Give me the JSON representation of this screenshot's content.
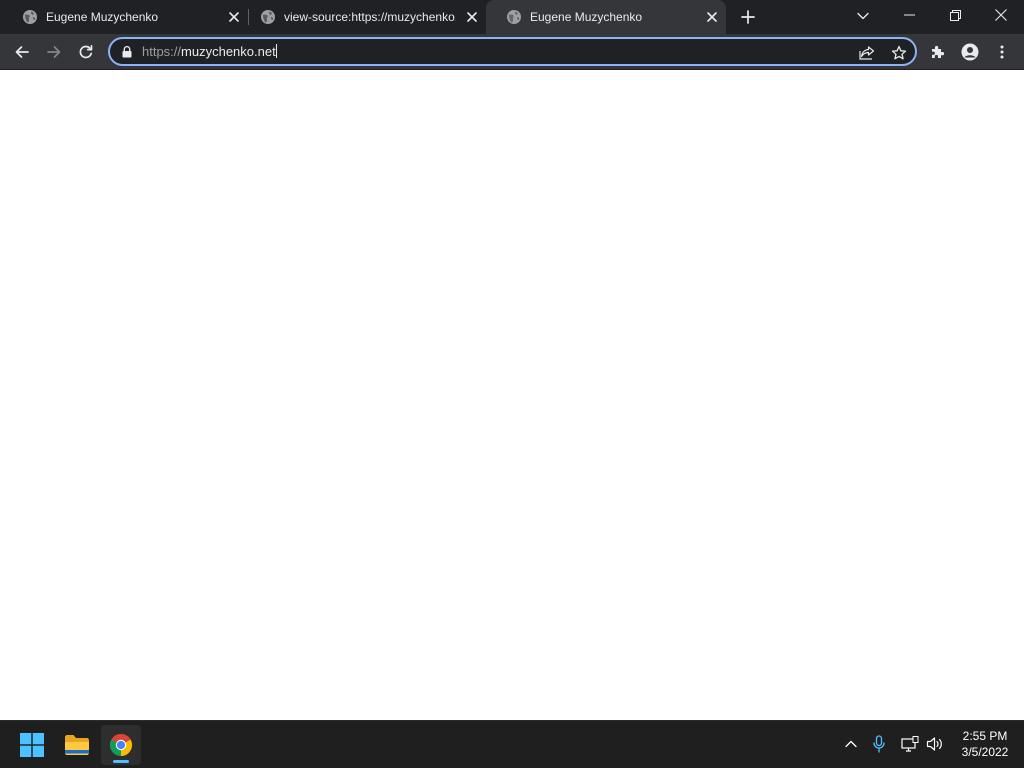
{
  "browser": {
    "tabs": [
      {
        "title": "Eugene Muzychenko",
        "active": false,
        "favicon": "globe-icon"
      },
      {
        "title": "view-source:https://muzychenko.net/",
        "active": false,
        "favicon": "globe-icon"
      },
      {
        "title": "Eugene Muzychenko",
        "active": true,
        "favicon": "globe-icon"
      }
    ],
    "omnibox": {
      "scheme": "https://",
      "host": "muzychenko.net"
    },
    "icons": {
      "back": "arrow-left-icon",
      "forward": "arrow-right-icon",
      "reload": "reload-icon",
      "lock": "lock-icon",
      "share": "share-icon",
      "bookmark": "star-icon",
      "extensions": "puzzle-icon",
      "profile": "person-icon",
      "menu": "kebab-menu-icon"
    }
  },
  "taskbar": {
    "apps": [
      {
        "name": "start",
        "icon": "windows-logo-icon"
      },
      {
        "name": "file-explorer",
        "icon": "folder-icon"
      },
      {
        "name": "chrome",
        "icon": "chrome-icon",
        "active": true
      }
    ],
    "tray": {
      "icons": [
        "chevron-up-icon",
        "microphone-icon",
        "network-icon",
        "volume-icon"
      ]
    },
    "clock": {
      "time": "2:55 PM",
      "date": "3/5/2022"
    }
  },
  "colors": {
    "tab_strip": "#202124",
    "toolbar": "#35363a",
    "omnibox_border": "#8ab4f8",
    "accent": "#4cc2ff",
    "taskbar": "#1f1f1f"
  }
}
